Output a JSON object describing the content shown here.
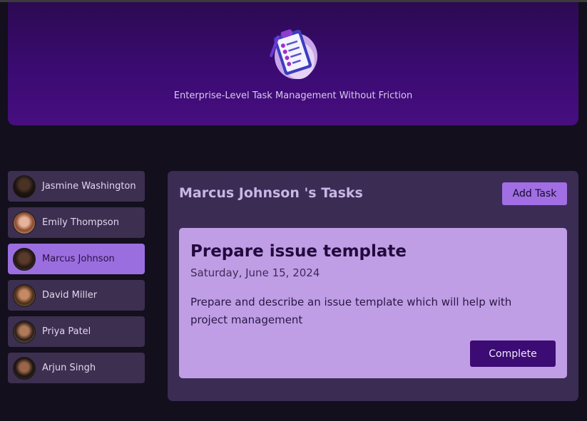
{
  "header": {
    "logo_icon": "clipboard-checklist-icon",
    "tagline": "Enterprise-Level Task Management Without Friction"
  },
  "sidebar": {
    "users": [
      {
        "name": "Jasmine Washington",
        "active": false
      },
      {
        "name": "Emily Thompson",
        "active": false
      },
      {
        "name": "Marcus Johnson",
        "active": true
      },
      {
        "name": "David Miller",
        "active": false
      },
      {
        "name": "Priya Patel",
        "active": false
      },
      {
        "name": "Arjun Singh",
        "active": false
      }
    ]
  },
  "main": {
    "title": "Marcus Johnson 's Tasks",
    "add_label": "Add Task",
    "tasks": [
      {
        "title": "Prepare issue template",
        "date": "Saturday, June 15, 2024",
        "description": "Prepare and describe an issue template which will help with project management",
        "complete_label": "Complete"
      }
    ]
  },
  "colors": {
    "header_top": "#2c0a52",
    "header_bottom": "#470e80",
    "active_user": "#9b6ee0",
    "card": "#bf9ee6",
    "complete_button": "#3c0b73"
  }
}
